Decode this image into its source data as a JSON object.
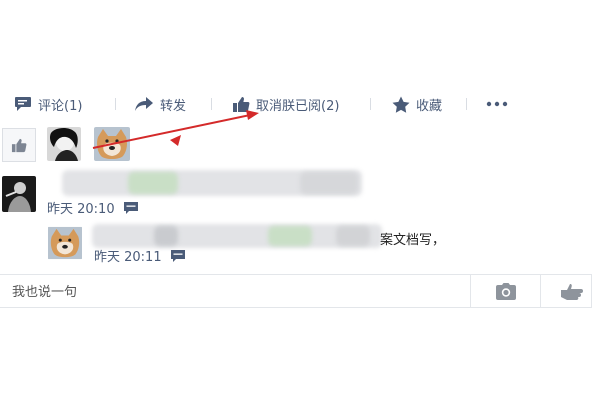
{
  "actions": {
    "comment": "评论(1)",
    "forward": "转发",
    "unlike": "取消朕已阅(2)",
    "favorite": "收藏"
  },
  "comments": [
    {
      "time": "昨天 20:10"
    },
    {
      "time": "昨天 20:11",
      "tail": "案文档写，"
    }
  ],
  "input": {
    "placeholder": "我也说一句"
  },
  "colors": {
    "accent": "#4a5b78",
    "annotation": "#d42a2a",
    "blur_gray": "#dcdde0",
    "blur_green": "#c8e0c4"
  },
  "icons": {
    "comment": "comment-icon",
    "forward": "forward-arrow-icon",
    "like": "thumbs-up-icon",
    "favorite": "star-icon",
    "more": "more-dots-icon",
    "camera": "camera-icon",
    "send": "thumb-gesture-icon"
  }
}
